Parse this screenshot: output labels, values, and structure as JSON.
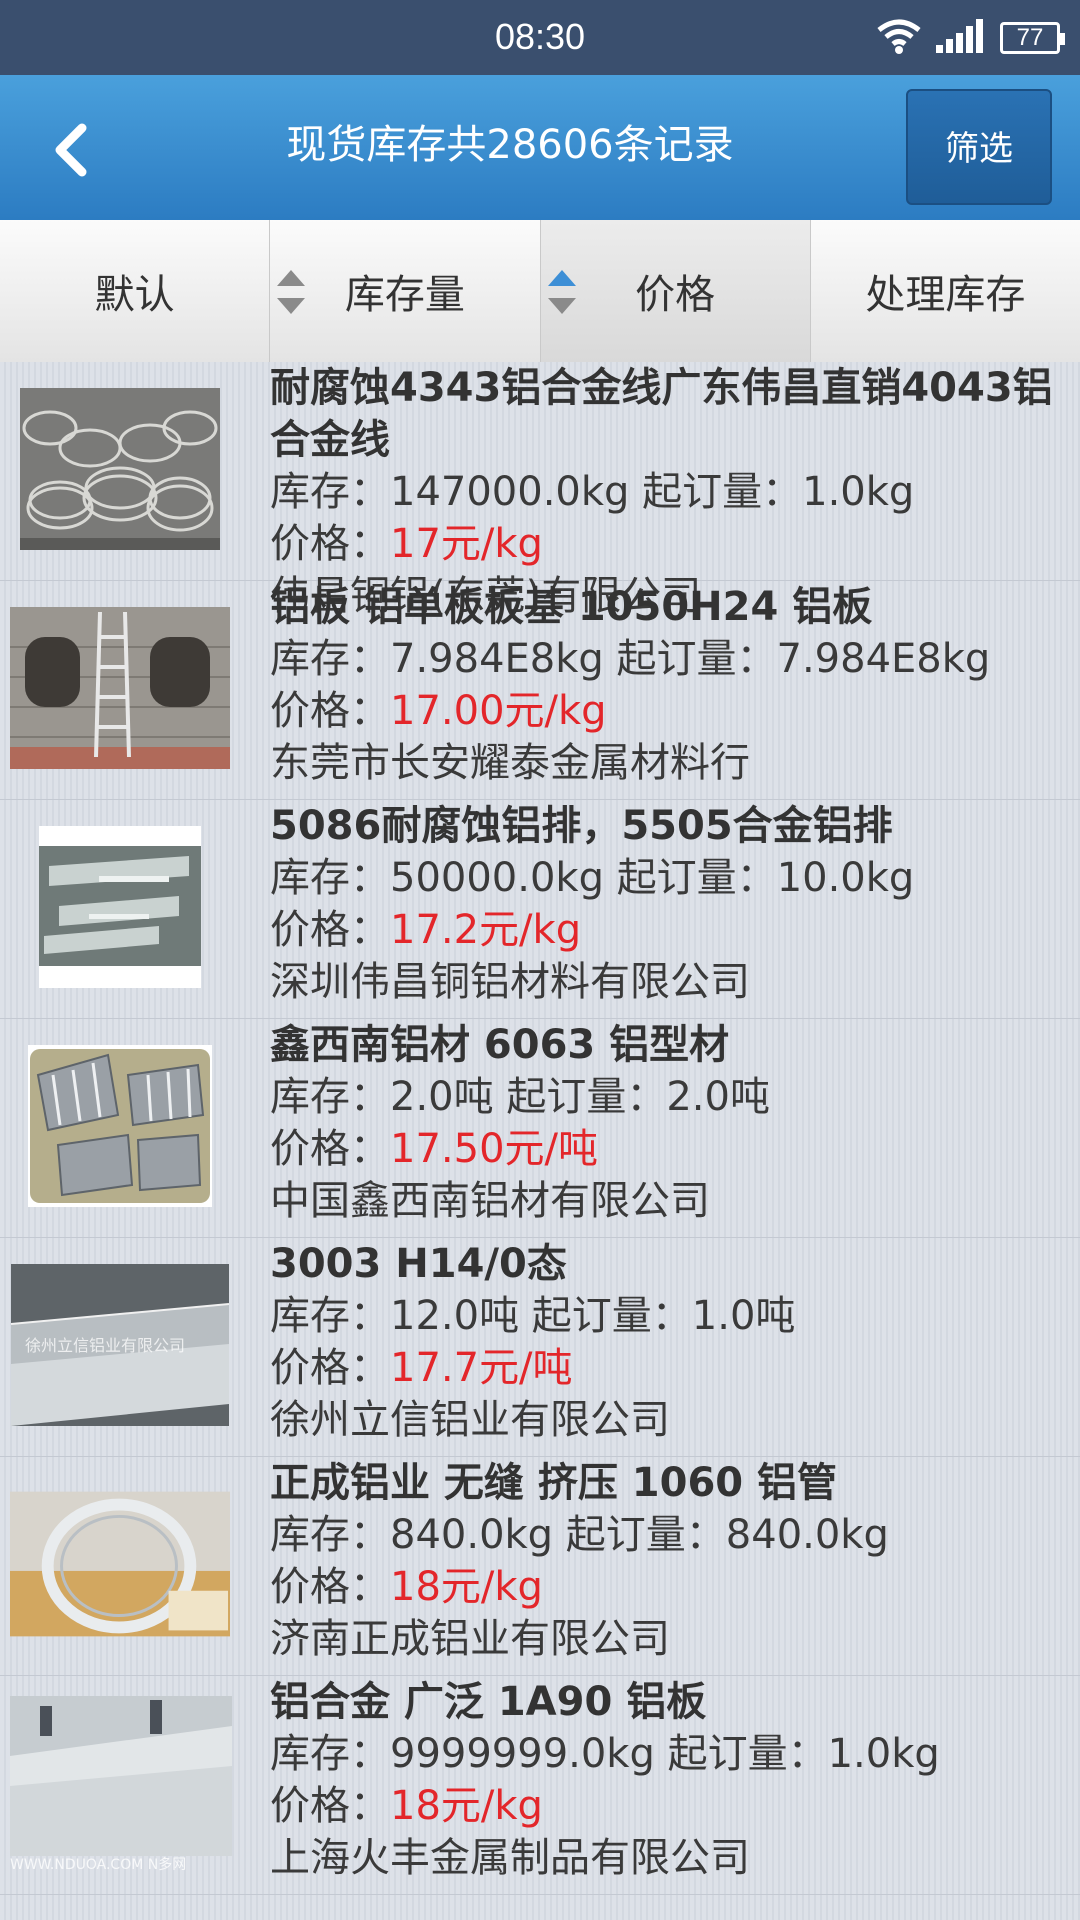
{
  "status_bar": {
    "time": "08:30",
    "battery": "77"
  },
  "header": {
    "back_icon": "chevron-left-icon",
    "title": "现货库存共28606条记录",
    "filter_label": "筛选"
  },
  "sort_tabs": [
    {
      "label": "默认"
    },
    {
      "label": "库存量"
    },
    {
      "label": "价格"
    },
    {
      "label": "处理库存"
    }
  ],
  "labels": {
    "stock": "库存：",
    "min_order": "起订量：",
    "price": "价格："
  },
  "items": [
    {
      "name": "耐腐蚀4343铝合金线广东伟昌直销4043铝合金线",
      "stock": "147000.0kg",
      "min_order": "1.0kg",
      "price": "17元/kg",
      "company": "伟昌铜铝(东莞)有限公司"
    },
    {
      "name": "铝板 铝单板板基 1050H24 铝板",
      "stock": "7.984E8kg",
      "min_order": "7.984E8kg",
      "price": "17.00元/kg",
      "company": "东莞市长安耀泰金属材料行"
    },
    {
      "name": "5086耐腐蚀铝排，5505合金铝排",
      "stock": "50000.0kg",
      "min_order": "10.0kg",
      "price": "17.2元/kg",
      "company": "深圳伟昌铜铝材料有限公司"
    },
    {
      "name": "鑫西南铝材 6063 铝型材",
      "stock": "2.0吨",
      "min_order": "2.0吨",
      "price": "17.50元/吨",
      "company": "中国鑫西南铝材有限公司"
    },
    {
      "name": "3003 H14/0态",
      "stock": "12.0吨",
      "min_order": "1.0吨",
      "price": "17.7元/吨",
      "company": "徐州立信铝业有限公司",
      "thumb_watermark": "徐州立信铝业有限公司"
    },
    {
      "name": "正成铝业 无缝 挤压 1060 铝管",
      "stock": "840.0kg",
      "min_order": "840.0kg",
      "price": "18元/kg",
      "company": "济南正成铝业有限公司"
    },
    {
      "name": "铝合金 广泛 1A90 铝板",
      "stock": "9999999.0kg",
      "min_order": "1.0kg",
      "price": "18元/kg",
      "company": "上海火丰金属制品有限公司",
      "thumb_watermark": "WWW.NDUOA.COM N多网"
    }
  ]
}
